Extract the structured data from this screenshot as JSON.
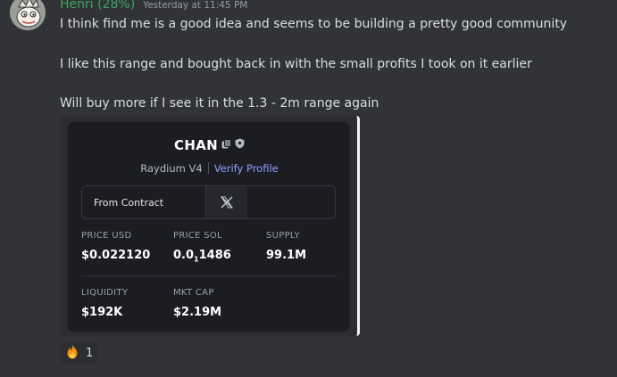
{
  "author": {
    "name": "Henri (28%)",
    "color": "#3ba55c",
    "timestamp": "Yesterday at 11:45 PM",
    "avatar_icon": "pepe-king-avatar-icon"
  },
  "message": {
    "line1": "I think find me is a good idea and seems to be building a pretty good community",
    "line2": "I like this range and bought back in with the small profits I took on it earlier",
    "line3": "Will buy more if I see it in the 1.3 - 2m range again"
  },
  "embed": {
    "token": "CHAN",
    "title_icons": [
      "copy-icon",
      "shield-icon"
    ],
    "dex": "Raydium V4",
    "verify_label": "Verify Profile",
    "contract_label": "From Contract",
    "x_icon": "x-logo-icon",
    "stats": {
      "price_usd_label": "PRICE USD",
      "price_usd": "$0.022120",
      "price_sol_label": "PRICE SOL",
      "price_sol_prefix": "0.0",
      "price_sol_zeros": "1",
      "price_sol_digits": "1486",
      "supply_label": "SUPPLY",
      "supply": "99.1M",
      "liquidity_label": "LIQUIDITY",
      "liquidity": "$192K",
      "mkt_cap_label": "MKT CAP",
      "mkt_cap": "$2.19M"
    }
  },
  "reaction": {
    "emoji": "fire-icon",
    "count": "1"
  }
}
